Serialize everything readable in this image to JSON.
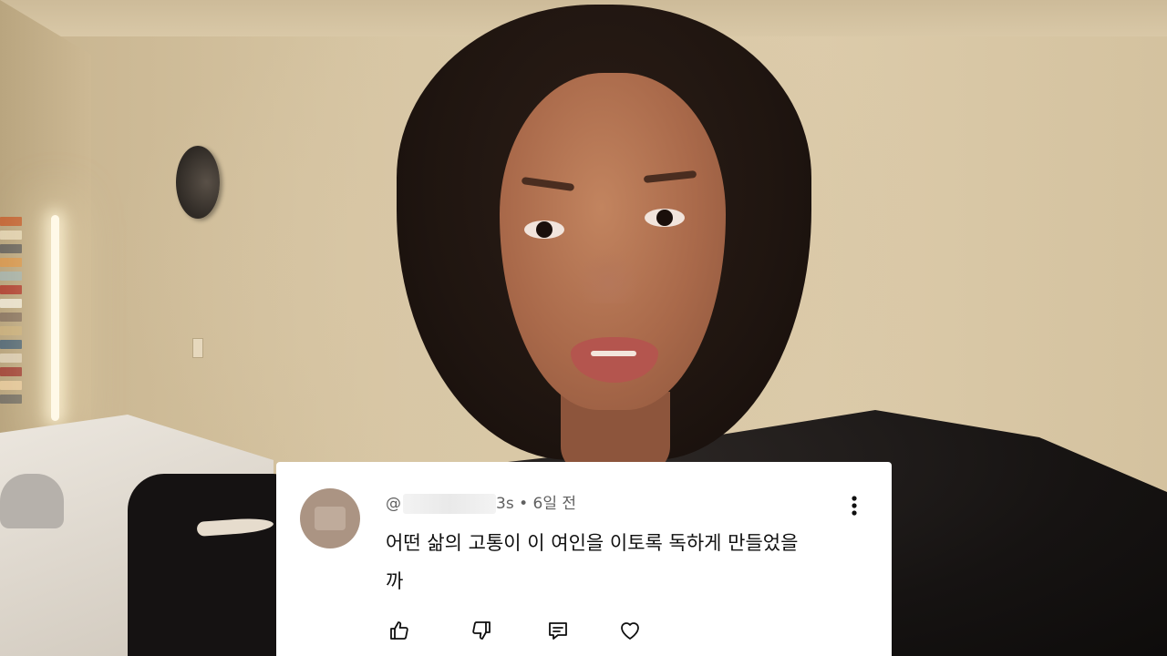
{
  "comment": {
    "handle_prefix": "@",
    "handle_suffix": "3s",
    "separator": "•",
    "timestamp": "6일 전",
    "text": "어떤 삶의 고통이 이 여인을 이토록 독하게 만들었을까"
  },
  "actions": {
    "like": "like-icon",
    "dislike": "dislike-icon",
    "reply": "reply-icon",
    "heart": "heart-icon",
    "more": "more-vertical-icon"
  },
  "colors": {
    "card_background": "#ffffff",
    "text_primary": "#0f0f0f",
    "text_secondary": "#606060",
    "avatar": "#ab9483"
  }
}
